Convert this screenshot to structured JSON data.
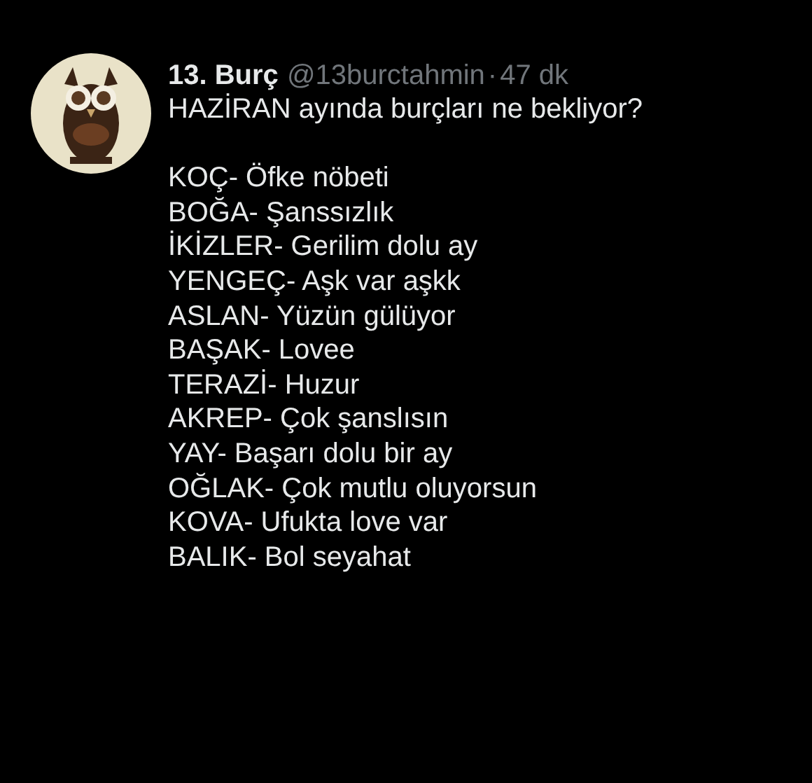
{
  "tweet": {
    "author": "13. Burç",
    "handle": "@13burctahmin",
    "separator": "·",
    "time": "47 dk",
    "intro": "HAZİRAN ayında burçları ne bekliyor?",
    "lines": [
      "KOÇ- Öfke nöbeti",
      "BOĞA- Şanssızlık",
      "İKİZLER- Gerilim dolu ay",
      "YENGEÇ- Aşk var aşkk",
      "ASLAN- Yüzün gülüyor",
      "BAŞAK- Lovee",
      "TERAZİ- Huzur",
      "AKREP- Çok şanslısın",
      "YAY- Başarı dolu bir ay",
      "OĞLAK- Çok mutlu oluyorsun",
      "KOVA- Ufukta love var",
      "BALIK- Bol seyahat"
    ]
  }
}
